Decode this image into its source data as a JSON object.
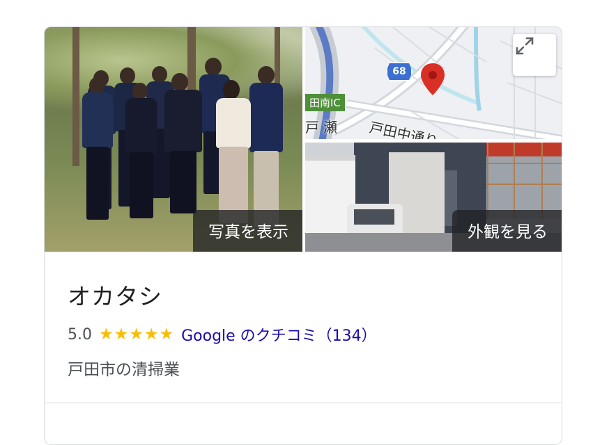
{
  "gallery": {
    "photos_label": "写真を表示",
    "exterior_label": "外観を見る",
    "map": {
      "route_number": "68",
      "ic_label": "田南IC",
      "area_label": "戸瀬",
      "road_label": "戸田中通り",
      "marker_color": "#d93025"
    }
  },
  "business": {
    "name": "オカタシ",
    "rating": "5.0",
    "stars": "★★★★★",
    "review_link": "Google のクチコミ（134）",
    "category": "戸田市の清掃業"
  },
  "colors": {
    "link": "#1a0dab",
    "star": "#fbbc04",
    "text_secondary": "#4d5156"
  }
}
